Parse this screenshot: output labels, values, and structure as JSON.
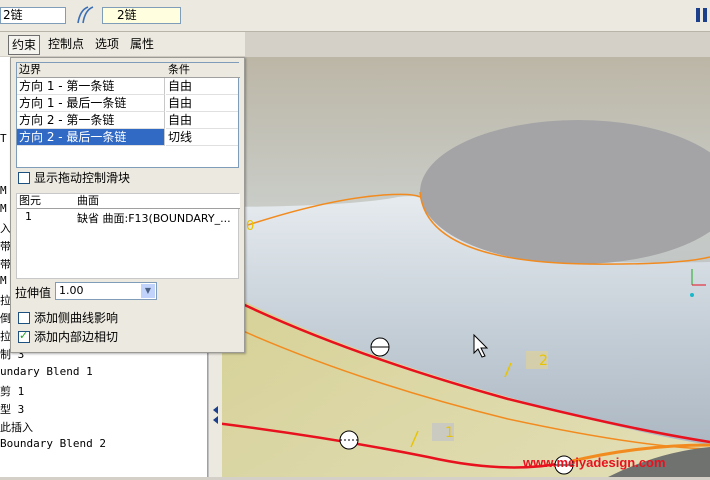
{
  "toolbar": {
    "chain_field": "2链",
    "chain_label": "2链",
    "chain_icon": "chain-icon",
    "pause_icon": "pause-icon"
  },
  "tabs": [
    {
      "label": "约束",
      "active": true
    },
    {
      "label": "控制点",
      "active": false
    },
    {
      "label": "选项",
      "active": false
    },
    {
      "label": "属性",
      "active": false
    }
  ],
  "constraints_table": {
    "headers": [
      "边界",
      "条件"
    ],
    "rows": [
      {
        "boundary": "方向 1 - 第一条链",
        "condition": "自由",
        "selected": false
      },
      {
        "boundary": "方向 1 - 最后一条链",
        "condition": "自由",
        "selected": false
      },
      {
        "boundary": "方向 2 - 第一条链",
        "condition": "自由",
        "selected": false
      },
      {
        "boundary": "方向 2 - 最后一条链",
        "condition": "切线",
        "selected": true
      }
    ]
  },
  "show_drag_handles": {
    "label": "显示拖动控制滑块",
    "checked": false
  },
  "surface_table": {
    "headers": [
      "图元",
      "曲面"
    ],
    "rows": [
      {
        "entity": "1",
        "surface": "缺省  曲面:F13(BOUNDARY_..."
      }
    ]
  },
  "stretch": {
    "label": "拉伸值",
    "value": "1.00"
  },
  "add_side_curve": {
    "label": "添加侧曲线影响",
    "checked": false
  },
  "add_inner_tangent": {
    "label": "添加内部边相切",
    "checked": true
  },
  "tree_items": [
    "T",
    "M",
    "M",
    "M",
    "入",
    "带",
    "带",
    "M",
    "拉",
    "倒",
    "拉",
    "制 3",
    "undary Blend 1",
    "剪 1",
    "型 3",
    "此插入",
    "Boundary Blend 2"
  ],
  "viewport_labels": {
    "label_0": "0",
    "label_1": "1",
    "label_2": "2"
  },
  "watermark": "www.meiyadesign.com",
  "colors": {
    "selected_row": "#316ac5",
    "boundary_red": "#e8111e",
    "accent_orange": "#f28b1f"
  }
}
